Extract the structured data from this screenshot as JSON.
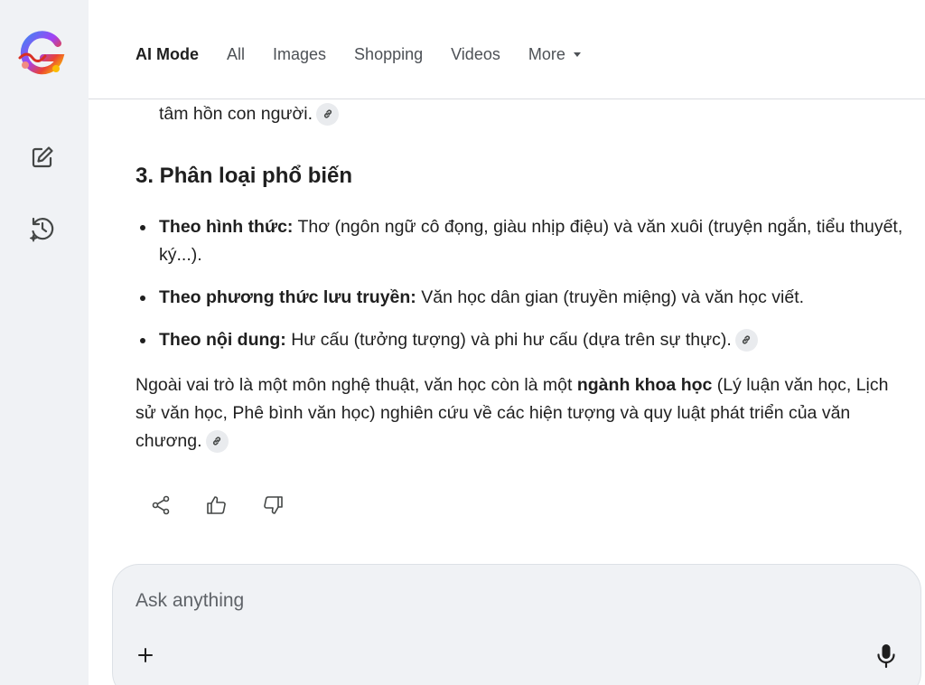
{
  "tabs": {
    "ai_mode": "AI Mode",
    "all": "All",
    "images": "Images",
    "shopping": "Shopping",
    "videos": "Videos",
    "more": "More"
  },
  "answer": {
    "prev_line": "tâm hồn con người.",
    "heading": "3. Phân loại phổ biến",
    "bullets": [
      {
        "bold": "Theo hình thức:",
        "text": " Thơ (ngôn ngữ cô đọng, giàu nhịp điệu) và văn xuôi (truyện ngắn, tiểu thuyết, ký...)."
      },
      {
        "bold": "Theo phương thức lưu truyền:",
        "text": " Văn học dân gian (truyền miệng) và văn học viết."
      },
      {
        "bold": "Theo nội dung:",
        "text": " Hư cấu (tưởng tượng) và phi hư cấu (dựa trên sự thực)."
      }
    ],
    "para_start": "Ngoài vai trò là một môn nghệ thuật, văn học còn là một ",
    "para_bold": "ngành khoa học",
    "para_end": " (Lý luận văn học, Lịch sử văn học, Phê bình văn học) nghiên cứu về các hiện tượng và quy luật phát triển của văn chương."
  },
  "composer": {
    "placeholder": "Ask anything"
  },
  "icons": {
    "logo": "google-ai-logo",
    "new_chat": "edit-icon",
    "history": "history-icon",
    "link": "link-icon",
    "share": "share-icon",
    "thumbs_up": "thumbs-up-icon",
    "thumbs_down": "thumbs-down-icon",
    "plus": "plus-icon",
    "mic": "mic-icon"
  },
  "colors": {
    "sidebar_bg": "#f0f2f5",
    "text": "#1f1f1f",
    "muted": "#4d5156",
    "composer_bg": "#f0f2f5"
  }
}
